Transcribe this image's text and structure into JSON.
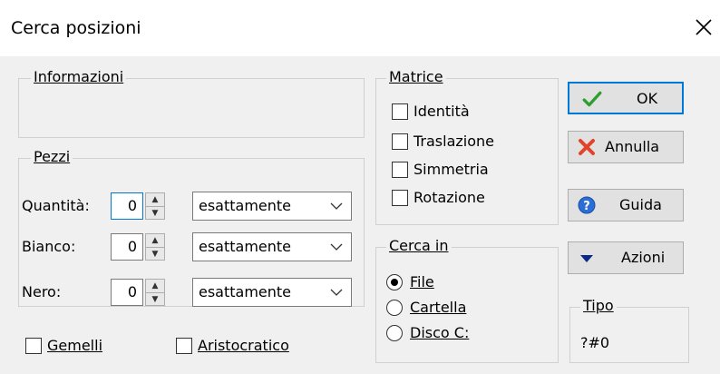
{
  "window": {
    "title": "Cerca posizioni"
  },
  "informazioni": {
    "label": "Informazioni"
  },
  "pezzi": {
    "label": "Pezzi",
    "rows": [
      {
        "label": "Quantità:",
        "value": "0",
        "mode": "esattamente"
      },
      {
        "label": "Bianco:",
        "value": "0",
        "mode": "esattamente"
      },
      {
        "label": "Nero:",
        "value": "0",
        "mode": "esattamente"
      }
    ]
  },
  "checkboxes": {
    "gemelli": "Gemelli",
    "aristocratico": "Aristocratico"
  },
  "matrice": {
    "label": "Matrice",
    "items": [
      "Identità",
      "Traslazione",
      "Simmetria",
      "Rotazione"
    ]
  },
  "cerca_in": {
    "label": "Cerca in",
    "options": [
      "File",
      "Cartella",
      "Disco C:"
    ],
    "selected": "File"
  },
  "buttons": {
    "ok": "OK",
    "annulla": "Annulla",
    "guida": "Guida",
    "azioni": "Azioni"
  },
  "tipo": {
    "label": "Tipo",
    "value": "?#0"
  },
  "colors": {
    "accent": "#0078d7",
    "check_green": "#2e9e2e",
    "cancel_red": "#e0442a"
  }
}
